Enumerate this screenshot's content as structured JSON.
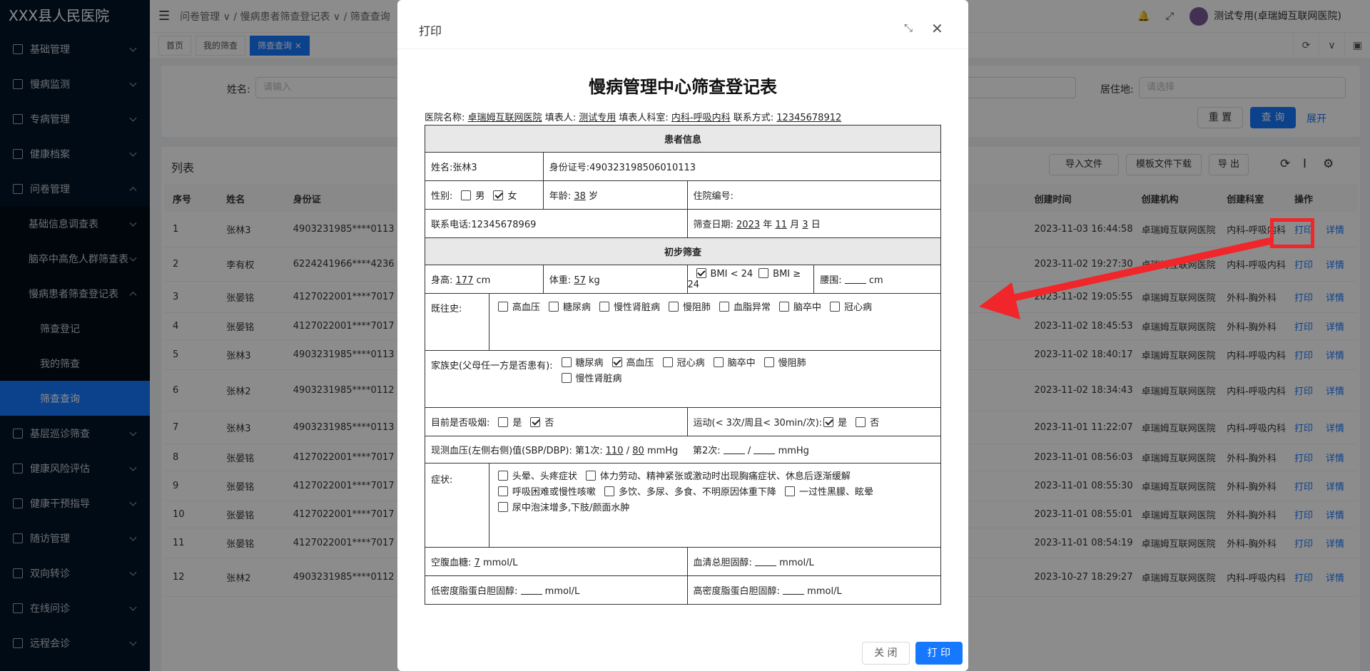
{
  "app": {
    "title": "XXX县人民医院"
  },
  "sidebar": {
    "items": [
      {
        "label": "基础管理"
      },
      {
        "label": "慢病监测"
      },
      {
        "label": "专病管理"
      },
      {
        "label": "健康档案"
      },
      {
        "label": "问卷管理"
      },
      {
        "label": "基础信息调查表"
      },
      {
        "label": "脑卒中高危人群筛查表"
      },
      {
        "label": "慢病患者筛查登记表"
      },
      {
        "label": "筛查登记"
      },
      {
        "label": "我的筛查"
      },
      {
        "label": "筛查查询"
      },
      {
        "label": "基层巡诊筛查"
      },
      {
        "label": "健康风险评估"
      },
      {
        "label": "健康干预指导"
      },
      {
        "label": "随访管理"
      },
      {
        "label": "双向转诊"
      },
      {
        "label": "在线问诊"
      },
      {
        "label": "远程会诊"
      }
    ]
  },
  "header": {
    "breadcrumb": [
      "问卷管理",
      "慢病患者筛查登记表",
      "筛查查询"
    ],
    "user": "测试专用(卓瑞姆互联网医院)"
  },
  "tabs": [
    "首页",
    "我的筛查",
    "筛查查询"
  ],
  "search": {
    "name_label": "姓名:",
    "name_placeholder": "请输入",
    "residence_label": "居住地:",
    "residence_placeholder": "请选择",
    "reset": "重 置",
    "query": "查 询",
    "expand": "展开"
  },
  "list": {
    "title": "列表",
    "import": "导入文件",
    "template": "模板文件下载",
    "export": "导 出",
    "columns": [
      "序号",
      "姓名",
      "身份证",
      "创建时间",
      "创建机构",
      "创建科室",
      "操作"
    ],
    "action_print": "打印",
    "action_detail": "详情",
    "rows": [
      {
        "no": "1",
        "name": "张林3",
        "id": "4903231985****0113",
        "time": "2023-11-03 16:44:58",
        "org": "卓瑞姆互联网医院",
        "dept": "内科-呼吸内科"
      },
      {
        "no": "2",
        "name": "李有权",
        "id": "6224241966****4236",
        "time": "2023-11-02 19:27:30",
        "org": "卓瑞姆互联网医院",
        "dept": "内科-呼吸内科"
      },
      {
        "no": "3",
        "name": "张晏铭",
        "id": "4127022001****7017",
        "time": "2023-11-02 19:05:55",
        "org": "卓瑞姆互联网医院",
        "dept": "外科-胸外科"
      },
      {
        "no": "4",
        "name": "张晏铭",
        "id": "4127022001****7017",
        "time": "2023-11-02 18:45:53",
        "org": "卓瑞姆互联网医院",
        "dept": "外科-胸外科"
      },
      {
        "no": "5",
        "name": "张林3",
        "id": "4903231985****0113",
        "time": "2023-11-02 18:40:17",
        "org": "卓瑞姆互联网医院",
        "dept": "内科-呼吸内科"
      },
      {
        "no": "6",
        "name": "张林2",
        "id": "4903231985****0112",
        "time": "2023-11-02 18:34:43",
        "org": "卓瑞姆互联网医院",
        "dept": "内科-呼吸内科"
      },
      {
        "no": "7",
        "name": "张林3",
        "id": "4903231985****0113",
        "time": "2023-11-01 11:22:07",
        "org": "卓瑞姆互联网医院",
        "dept": "内科-呼吸内科"
      },
      {
        "no": "8",
        "name": "张晏铭",
        "id": "4127022001****7017",
        "time": "2023-11-01 08:56:03",
        "org": "卓瑞姆互联网医院",
        "dept": "外科-胸外科"
      },
      {
        "no": "9",
        "name": "张晏铭",
        "id": "4127022001****7017",
        "time": "2023-11-01 08:55:30",
        "org": "卓瑞姆互联网医院",
        "dept": "外科-胸外科"
      },
      {
        "no": "10",
        "name": "张晏铭",
        "id": "4127022001****7017",
        "time": "2023-11-01 08:55:01",
        "org": "卓瑞姆互联网医院",
        "dept": "外科-胸外科"
      },
      {
        "no": "11",
        "name": "张晏铭",
        "id": "4127022001****7017",
        "time": "2023-11-01 08:54:19",
        "org": "卓瑞姆互联网医院",
        "dept": "外科-胸外科"
      },
      {
        "no": "12",
        "name": "张林2",
        "id": "4903231985****0112",
        "time": "2023-10-27 18:29:27",
        "org": "卓瑞姆互联网医院",
        "dept": "内科-呼吸内科"
      }
    ]
  },
  "modal": {
    "title": "打印",
    "close": "关 闭",
    "print": "打 印",
    "form": {
      "title": "慢病管理中心筛查登记表",
      "hospital_label": "医院名称:",
      "hospital": "卓瑞姆互联网医院",
      "filler_label": "填表人:",
      "filler": "测试专用",
      "dept_label": "填表人科室:",
      "dept": "内科-呼吸内科",
      "contact_label": "联系方式:",
      "contact": "12345678912",
      "sec_patient": "患者信息",
      "name": "姓名:张林3",
      "idcard": "身份证号:490323198506010113",
      "gender_label": "性别:",
      "male": "男",
      "female": "女",
      "age_label": "年龄:",
      "age": "38",
      "age_unit": "岁",
      "inpatient": "住院编号:",
      "phone": "联系电话:12345678969",
      "date_label": "筛查日期:",
      "year": "2023",
      "month": "11",
      "day": "3",
      "y": "年",
      "m": "月",
      "d": "日",
      "sec_screen": "初步筛查",
      "height_label": "身高:",
      "height": "177",
      "cm": "cm",
      "weight_label": "体重:",
      "weight": "57",
      "kg": "kg",
      "bmi_lt": "BMI < 24",
      "bmi_ge": "BMI ≥ 24",
      "waist_label": "腰围:",
      "history_label": "既往史:",
      "history": [
        "高血压",
        "糖尿病",
        "慢性肾脏病",
        "慢阻肺",
        "血脂异常",
        "脑卒中",
        "冠心病"
      ],
      "family_label": "家族史(父母任一方是否患有):",
      "family": [
        "糖尿病",
        "高血压",
        "冠心病",
        "脑卒中",
        "慢阻肺",
        "慢性肾脏病"
      ],
      "smoke_label": "目前是否吸烟:",
      "yes": "是",
      "no": "否",
      "exercise_label": "运动(< 3次/周且< 30min/次):",
      "bp_label": "现测血压(左侧右侧)值(SBP/DBP):",
      "bp_first": "第1次:",
      "bp_sys": "110",
      "bp_dia": "80",
      "mmhg": "mmHg",
      "bp_second": "第2次:",
      "symptom_label": "症状:",
      "symptoms": [
        "头晕、头疼症状",
        "体力劳动、精神紧张或激动时出现胸痛症状、休息后逐渐缓解",
        "呼吸困难或慢性咳嗽",
        "多饮、多尿、多食、不明原因体重下降",
        "一过性黑朦、眩晕",
        "尿中泡沫增多,下肢/颜面水肿"
      ],
      "glucose_label": "空腹血糖:",
      "glucose": "7",
      "mmol": "mmol/L",
      "chol_label": "血清总胆固醇:",
      "ldl_label": "低密度脂蛋白胆固醇:",
      "hdl_label": "高密度脂蛋白胆固醇:"
    }
  }
}
